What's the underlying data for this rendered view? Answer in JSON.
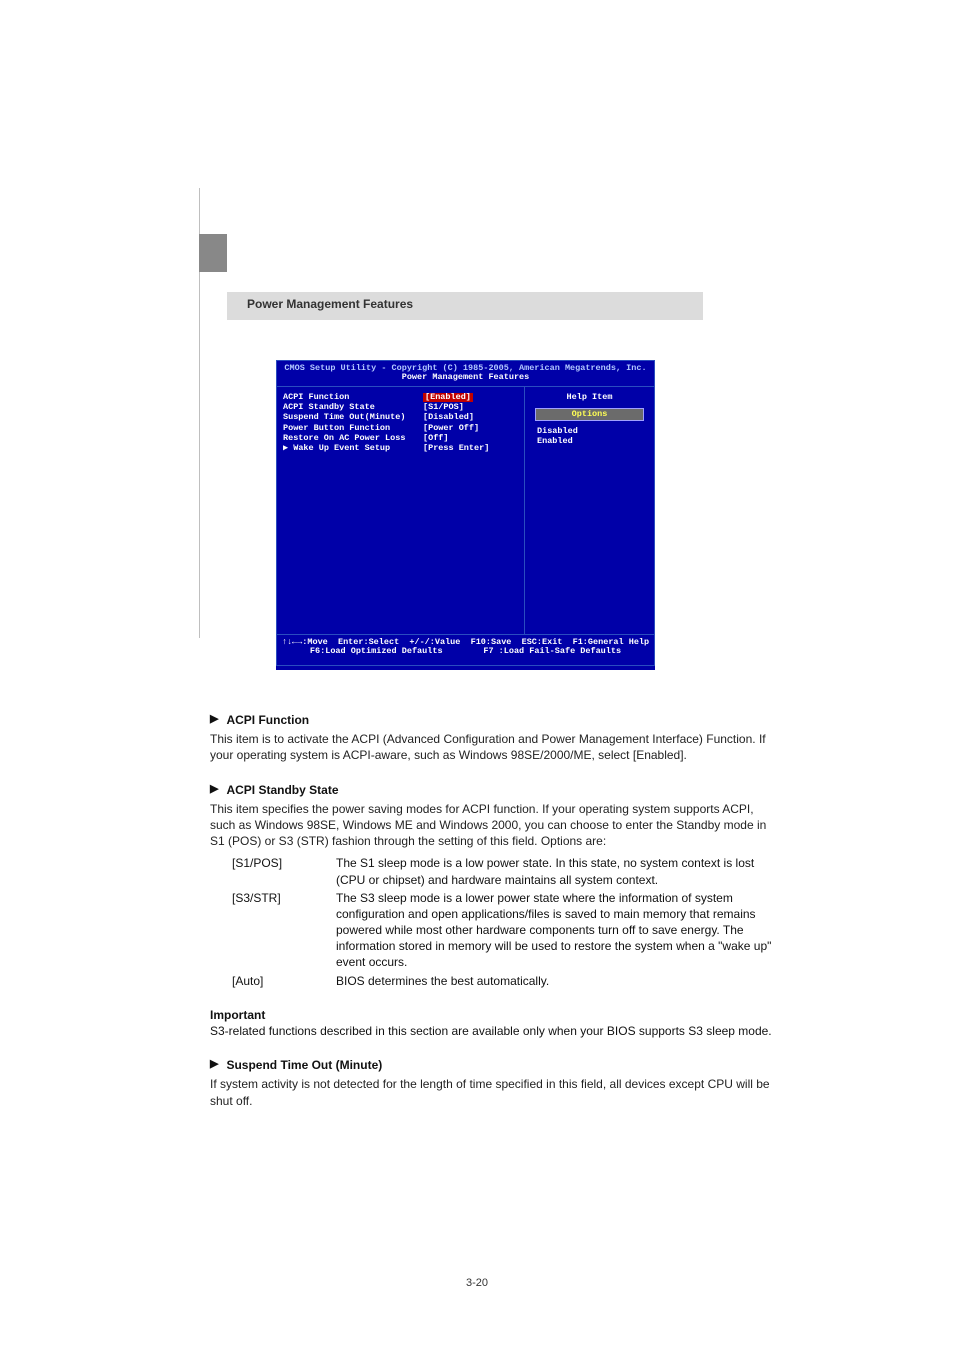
{
  "section_title": "Power Management Features",
  "bios": {
    "title_line1": "CMOS Setup Utility - Copyright (C) 1985-2005, American Megatrends, Inc.",
    "title_line2": "Power Management Features",
    "rows": [
      {
        "label": "ACPI Function",
        "value": "[Enabled]",
        "selected": true
      },
      {
        "label": "ACPI Standby State",
        "value": "[S1/POS]"
      },
      {
        "label": "Suspend Time Out(Minute)",
        "value": "[Disabled]"
      },
      {
        "label": "Power Button Function",
        "value": "[Power Off]"
      },
      {
        "label": "Restore On AC Power Loss",
        "value": "[Off]"
      },
      {
        "label": "▶ Wake Up Event Setup",
        "value": "[Press Enter]"
      }
    ],
    "help_item": "Help Item",
    "options_label": "Options",
    "options": [
      "Disabled",
      "Enabled"
    ],
    "footer_line1": "↑↓←→:Move  Enter:Select  +/-/:Value  F10:Save  ESC:Exit  F1:General Help",
    "footer_line2": "F6:Load Optimized Defaults        F7 :Load Fail-Safe Defaults"
  },
  "items": [
    {
      "title": "ACPI Function",
      "body": "This item is to activate the ACPI (Advanced Configuration and Power Management Interface) Function. If your operating system is ACPI-aware, such as Windows 98SE/2000/ME, select [Enabled]."
    },
    {
      "title": "ACPI Standby State",
      "body": "This item specifies the power saving modes for ACPI function. If your operating system supports ACPI, such as Windows 98SE, Windows ME and Windows 2000, you can choose to enter the Standby mode in S1 (POS) or S3 (STR) fashion through the setting of this field. Options are:",
      "opts": [
        {
          "k": "[S1/POS]",
          "v": "The S1 sleep mode is a low power state. In this state, no system context is lost (CPU or chipset) and hardware maintains all system context."
        },
        {
          "k": "[S3/STR]",
          "v": "The S3 sleep mode is a lower power state where the information of system configuration and open applications/files is saved to main memory that remains powered while most other hardware components turn off to save energy. The information stored in memory will be used to restore the system when a \"wake up\" event occurs."
        },
        {
          "k": "[Auto]",
          "v": "BIOS determines the best automatically."
        }
      ]
    },
    {
      "title": "Suspend Time Out (Minute)",
      "body": "If system activity is not detected for the length of time specified in this field, all devices except CPU will be shut off."
    }
  ],
  "important": {
    "label": "Important",
    "body": "S3-related functions described in this section are available only when your BIOS supports S3 sleep mode."
  },
  "page_number": "3-20"
}
